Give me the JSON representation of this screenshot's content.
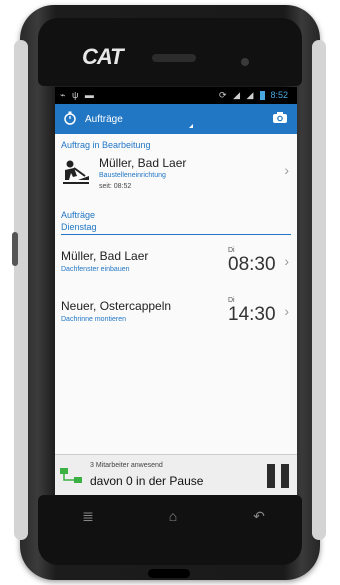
{
  "device": {
    "brand": "CAT"
  },
  "status_bar": {
    "time": "8:52"
  },
  "action_bar": {
    "title": "Aufträge"
  },
  "in_progress": {
    "heading": "Auftrag in Bearbeitung",
    "name": "Müller, Bad Laer",
    "subtitle": "Baustelleneinrichtung",
    "since": "seit: 08:52"
  },
  "orders": {
    "heading": "Aufträge",
    "filter": "Dienstag",
    "items": [
      {
        "name": "Müller, Bad Laer",
        "subtitle": "Dachfenster einbauen",
        "day": "Di",
        "time": "08:30"
      },
      {
        "name": "Neuer, Ostercappeln",
        "subtitle": "Dachrinne montieren",
        "day": "Di",
        "time": "14:30"
      }
    ]
  },
  "footer": {
    "present": "3 Mitarbeiter anwesend",
    "pause": "davon 0 in der Pause"
  },
  "icons": {
    "status_left": [
      "usb-icon",
      "signal-icon",
      "notification-icon"
    ],
    "status_right": [
      "sync-icon",
      "wifi-icon",
      "cell-signal-icon",
      "battery-icon"
    ],
    "action_left": "stopwatch-icon",
    "action_right": "camera-icon",
    "nav": [
      "menu-icon",
      "home-icon",
      "back-icon"
    ]
  },
  "colors": {
    "accent": "#2277c5"
  }
}
